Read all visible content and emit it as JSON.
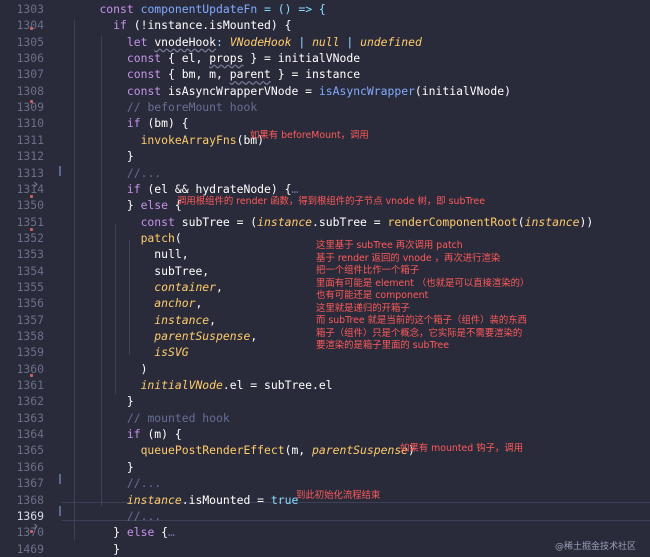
{
  "editor": {
    "lines": [
      {
        "n": "1303",
        "tokens": [
          {
            "t": "    ",
            "c": "tx"
          },
          {
            "t": "const",
            "c": "kw"
          },
          {
            "t": " componentUpdateFn",
            "c": "fn"
          },
          {
            "t": " = ",
            "c": "pn"
          },
          {
            "t": "() => {",
            "c": "pn"
          }
        ]
      },
      {
        "n": "1304",
        "tokens": [
          {
            "t": "      ",
            "c": "tx"
          },
          {
            "t": "if",
            "c": "kw"
          },
          {
            "t": " (!instance.isMounted) {",
            "c": "vr"
          }
        ]
      },
      {
        "n": "1305",
        "tokens": [
          {
            "t": "        ",
            "c": "tx"
          },
          {
            "t": "let",
            "c": "kw"
          },
          {
            "t": " vnodeHook",
            "c": "vr"
          },
          {
            "t": ": ",
            "c": "pn"
          },
          {
            "t": "VNodeHook",
            "c": "it"
          },
          {
            "t": " | ",
            "c": "pn"
          },
          {
            "t": "null",
            "c": "it"
          },
          {
            "t": " | ",
            "c": "pn"
          },
          {
            "t": "undefined",
            "c": "it"
          }
        ]
      },
      {
        "n": "1306",
        "tokens": [
          {
            "t": "        ",
            "c": "tx"
          },
          {
            "t": "const",
            "c": "kw"
          },
          {
            "t": " { el, props } = initialVNode",
            "c": "vr"
          }
        ]
      },
      {
        "n": "1307",
        "tokens": [
          {
            "t": "        ",
            "c": "tx"
          },
          {
            "t": "const",
            "c": "kw"
          },
          {
            "t": " { bm, m, parent } = instance",
            "c": "vr"
          }
        ]
      },
      {
        "n": "1308",
        "tokens": [
          {
            "t": "        ",
            "c": "tx"
          },
          {
            "t": "const",
            "c": "kw"
          },
          {
            "t": " isAsyncWrapperVNode = ",
            "c": "vr"
          },
          {
            "t": "isAsyncWrapper",
            "c": "fn"
          },
          {
            "t": "(initialVNode)",
            "c": "vr"
          }
        ]
      },
      {
        "n": "1309",
        "tokens": [
          {
            "t": "        ",
            "c": "tx"
          },
          {
            "t": "// beforeMount hook",
            "c": "cm"
          }
        ]
      },
      {
        "n": "1310",
        "tokens": [
          {
            "t": "        ",
            "c": "tx"
          },
          {
            "t": "if",
            "c": "kw"
          },
          {
            "t": " (bm) {",
            "c": "vr"
          }
        ]
      },
      {
        "n": "1311",
        "tokens": [
          {
            "t": "          ",
            "c": "tx"
          },
          {
            "t": "invokeArrayFns",
            "c": "ty"
          },
          {
            "t": "(bm)",
            "c": "vr"
          }
        ]
      },
      {
        "n": "1312",
        "tokens": [
          {
            "t": "        }",
            "c": "vr"
          }
        ]
      },
      {
        "n": "1313",
        "tokens": [
          {
            "t": "        ",
            "c": "tx"
          },
          {
            "t": "//...",
            "c": "cm"
          }
        ]
      },
      {
        "n": "1314",
        "tokens": [
          {
            "t": "        ",
            "c": "tx"
          },
          {
            "t": "if",
            "c": "kw"
          },
          {
            "t": " (el && hydrateNode) {",
            "c": "vr"
          },
          {
            "t": "…",
            "c": "cm"
          }
        ]
      },
      {
        "n": "1350",
        "tokens": [
          {
            "t": "        } ",
            "c": "vr"
          },
          {
            "t": "else",
            "c": "kw"
          },
          {
            "t": " {",
            "c": "vr"
          }
        ]
      },
      {
        "n": "1351",
        "tokens": [
          {
            "t": "          ",
            "c": "tx"
          },
          {
            "t": "const",
            "c": "kw"
          },
          {
            "t": " subTree = (",
            "c": "vr"
          },
          {
            "t": "instance",
            "c": "it"
          },
          {
            "t": ".subTree = ",
            "c": "vr"
          },
          {
            "t": "renderComponentRoot",
            "c": "ty"
          },
          {
            "t": "(",
            "c": "vr"
          },
          {
            "t": "instance",
            "c": "it"
          },
          {
            "t": "))",
            "c": "vr"
          }
        ]
      },
      {
        "n": "1352",
        "tokens": [
          {
            "t": "          ",
            "c": "tx"
          },
          {
            "t": "patch",
            "c": "ty"
          },
          {
            "t": "(",
            "c": "vr"
          }
        ]
      },
      {
        "n": "1353",
        "tokens": [
          {
            "t": "            null,",
            "c": "vr"
          }
        ]
      },
      {
        "n": "1354",
        "tokens": [
          {
            "t": "            subTree,",
            "c": "vr"
          }
        ]
      },
      {
        "n": "1355",
        "tokens": [
          {
            "t": "            ",
            "c": "tx"
          },
          {
            "t": "container",
            "c": "it"
          },
          {
            "t": ",",
            "c": "vr"
          }
        ]
      },
      {
        "n": "1356",
        "tokens": [
          {
            "t": "            ",
            "c": "tx"
          },
          {
            "t": "anchor",
            "c": "it"
          },
          {
            "t": ",",
            "c": "vr"
          }
        ]
      },
      {
        "n": "1357",
        "tokens": [
          {
            "t": "            ",
            "c": "tx"
          },
          {
            "t": "instance",
            "c": "it"
          },
          {
            "t": ",",
            "c": "vr"
          }
        ]
      },
      {
        "n": "1358",
        "tokens": [
          {
            "t": "            ",
            "c": "tx"
          },
          {
            "t": "parentSuspense",
            "c": "it"
          },
          {
            "t": ",",
            "c": "vr"
          }
        ]
      },
      {
        "n": "1359",
        "tokens": [
          {
            "t": "            ",
            "c": "tx"
          },
          {
            "t": "isSVG",
            "c": "it"
          }
        ]
      },
      {
        "n": "1360",
        "tokens": [
          {
            "t": "          )",
            "c": "vr"
          }
        ]
      },
      {
        "n": "1361",
        "tokens": [
          {
            "t": "          ",
            "c": "tx"
          },
          {
            "t": "initialVNode",
            "c": "it"
          },
          {
            "t": ".el = subTree.el",
            "c": "vr"
          }
        ]
      },
      {
        "n": "1362",
        "tokens": [
          {
            "t": "        }",
            "c": "vr"
          }
        ]
      },
      {
        "n": "1363",
        "tokens": [
          {
            "t": "        ",
            "c": "tx"
          },
          {
            "t": "// mounted hook",
            "c": "cm"
          }
        ]
      },
      {
        "n": "1364",
        "tokens": [
          {
            "t": "        ",
            "c": "tx"
          },
          {
            "t": "if",
            "c": "kw"
          },
          {
            "t": " (m) {",
            "c": "vr"
          }
        ]
      },
      {
        "n": "1365",
        "tokens": [
          {
            "t": "          ",
            "c": "tx"
          },
          {
            "t": "queuePostRenderEffect",
            "c": "ty"
          },
          {
            "t": "(m, ",
            "c": "vr"
          },
          {
            "t": "parentSuspense",
            "c": "it"
          },
          {
            "t": ")",
            "c": "vr"
          }
        ]
      },
      {
        "n": "1366",
        "tokens": [
          {
            "t": "        }",
            "c": "vr"
          }
        ]
      },
      {
        "n": "1367",
        "tokens": [
          {
            "t": "        ",
            "c": "tx"
          },
          {
            "t": "//...",
            "c": "cm"
          }
        ]
      },
      {
        "n": "1368",
        "tokens": [
          {
            "t": "        ",
            "c": "tx"
          },
          {
            "t": "instance",
            "c": "it"
          },
          {
            "t": ".isMounted = ",
            "c": "vr"
          },
          {
            "t": "true",
            "c": "pn"
          }
        ]
      },
      {
        "n": "1369",
        "tokens": [
          {
            "t": "        ",
            "c": "tx"
          },
          {
            "t": "//...",
            "c": "cm"
          }
        ]
      },
      {
        "n": "1370",
        "tokens": [
          {
            "t": "      } ",
            "c": "vr"
          },
          {
            "t": "else",
            "c": "kw"
          },
          {
            "t": " {",
            "c": "vr"
          },
          {
            "t": "…",
            "c": "cm"
          }
        ]
      },
      {
        "n": "1469",
        "tokens": [
          {
            "t": "      }",
            "c": "vr"
          }
        ]
      }
    ],
    "active_line": "1369"
  },
  "annotations": {
    "beforeMount": "如果有 beforeMount，调用",
    "render": "调用根组件的 render 函数，得到根组件的子节点 vnode 树，即 subTree",
    "patch_lines": [
      "这里基于 subTree 再次调用 patch",
      "基于 render 返回的 vnode ，再次进行渲染",
      "把一个组件比作一个箱子",
      "里面有可能是 element （也就是可以直接渲染的）",
      "也有可能还是 component",
      "这里就是递归的开箱子",
      "而 subTree 就是当前的这个箱子（组件）装的东西",
      "箱子（组件）只是个概念，它实际是不需要渲染的",
      "要渲染的是箱子里面的 subTree"
    ],
    "mounted": "如果有 mounted 钩子，调用",
    "finish": "到此初始化流程结束"
  },
  "watermark": "@稀土掘金技术社区"
}
